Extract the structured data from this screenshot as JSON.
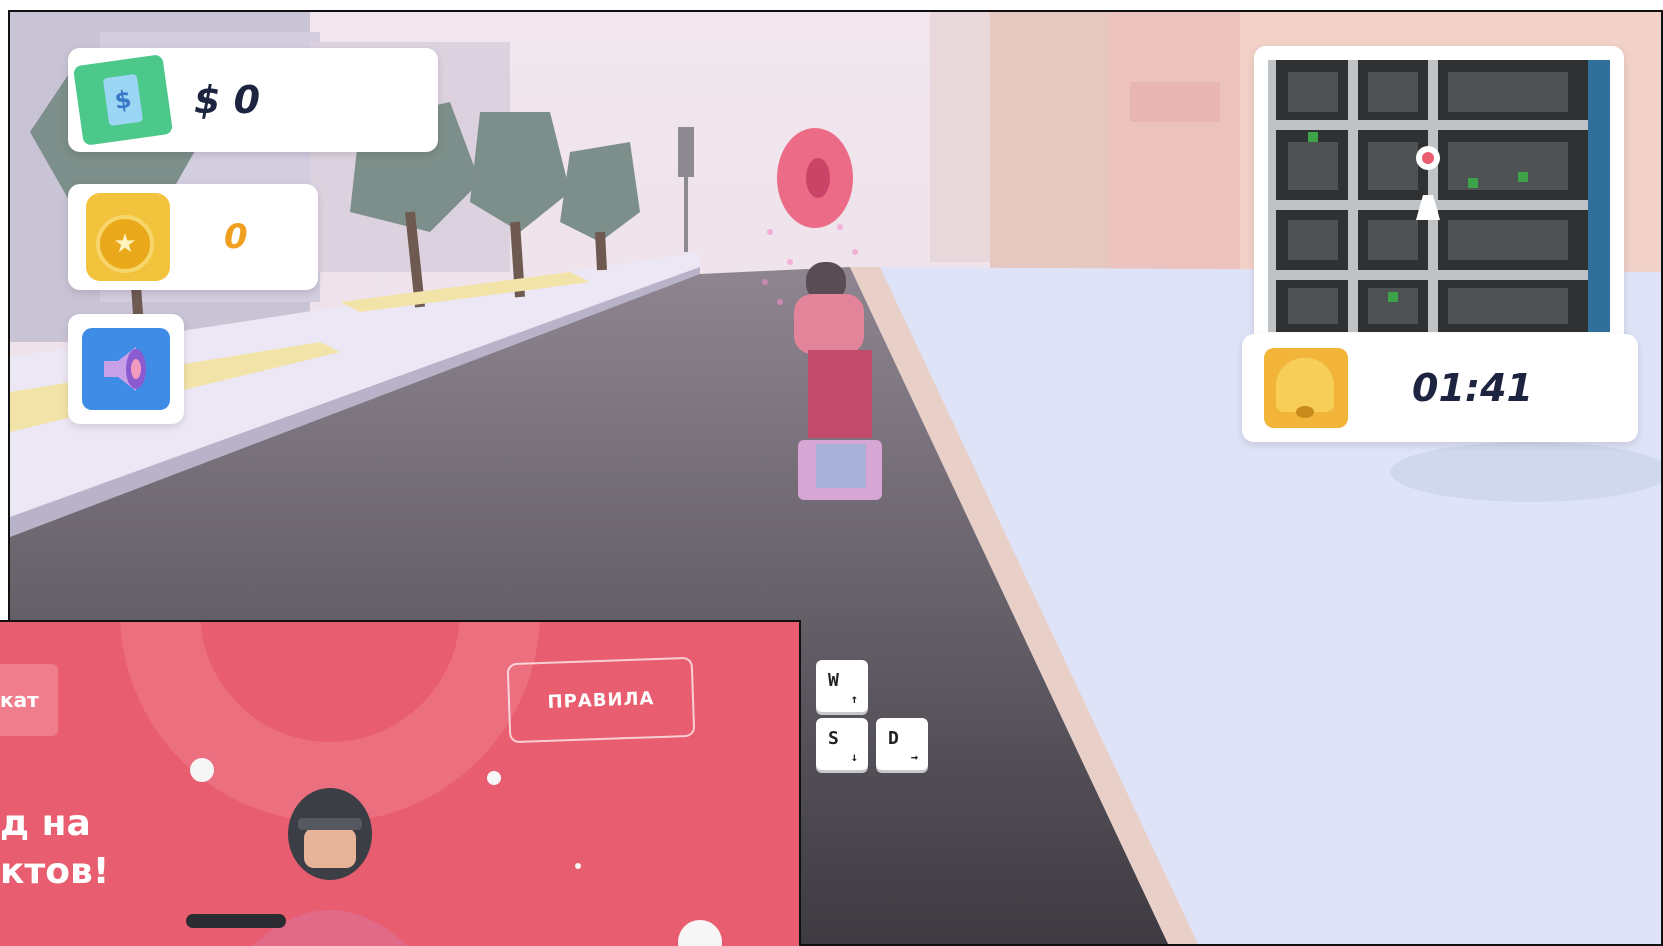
{
  "hud": {
    "money_value": "$ 0",
    "coins_value": "0",
    "timer_value": "01:41"
  },
  "icons": {
    "money": "cash-stack-icon",
    "coin": "medal-coin-icon",
    "sound": "speaker-icon",
    "clock": "alarm-bell-icon",
    "map_pin": "location-pin-icon"
  },
  "controls": {
    "keys": [
      {
        "letter": "W",
        "arrow": "↑"
      },
      {
        "letter": "S",
        "arrow": "↓"
      },
      {
        "letter": "D",
        "arrow": "→"
      }
    ]
  },
  "overlay": {
    "left_tab_partial": "кат",
    "rules_button": "ПРАВИЛА",
    "headline_line1": "д на",
    "headline_line2": "ктов!"
  },
  "colors": {
    "accent_pink": "#e85e70",
    "hud_text": "#1c2440",
    "coin_text": "#f0a020"
  }
}
